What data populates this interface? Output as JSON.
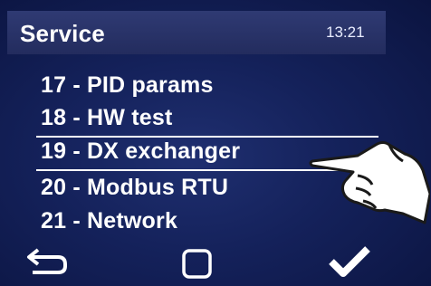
{
  "header": {
    "title": "Service",
    "time": "13:21"
  },
  "menu": {
    "items": [
      {
        "label": "17 - PID params"
      },
      {
        "label": "18 - HW test"
      },
      {
        "label": "19 - DX exchanger",
        "selected": true
      },
      {
        "label": "20 - Modbus RTU"
      },
      {
        "label": "21 - Network"
      }
    ]
  },
  "softkeys": {
    "left_icon": "back-arrow-icon",
    "center_icon": "square-icon",
    "right_icon": "checkmark-icon"
  },
  "colors": {
    "background": "#14215a",
    "header": "#2a3468",
    "text": "#ffffff"
  }
}
